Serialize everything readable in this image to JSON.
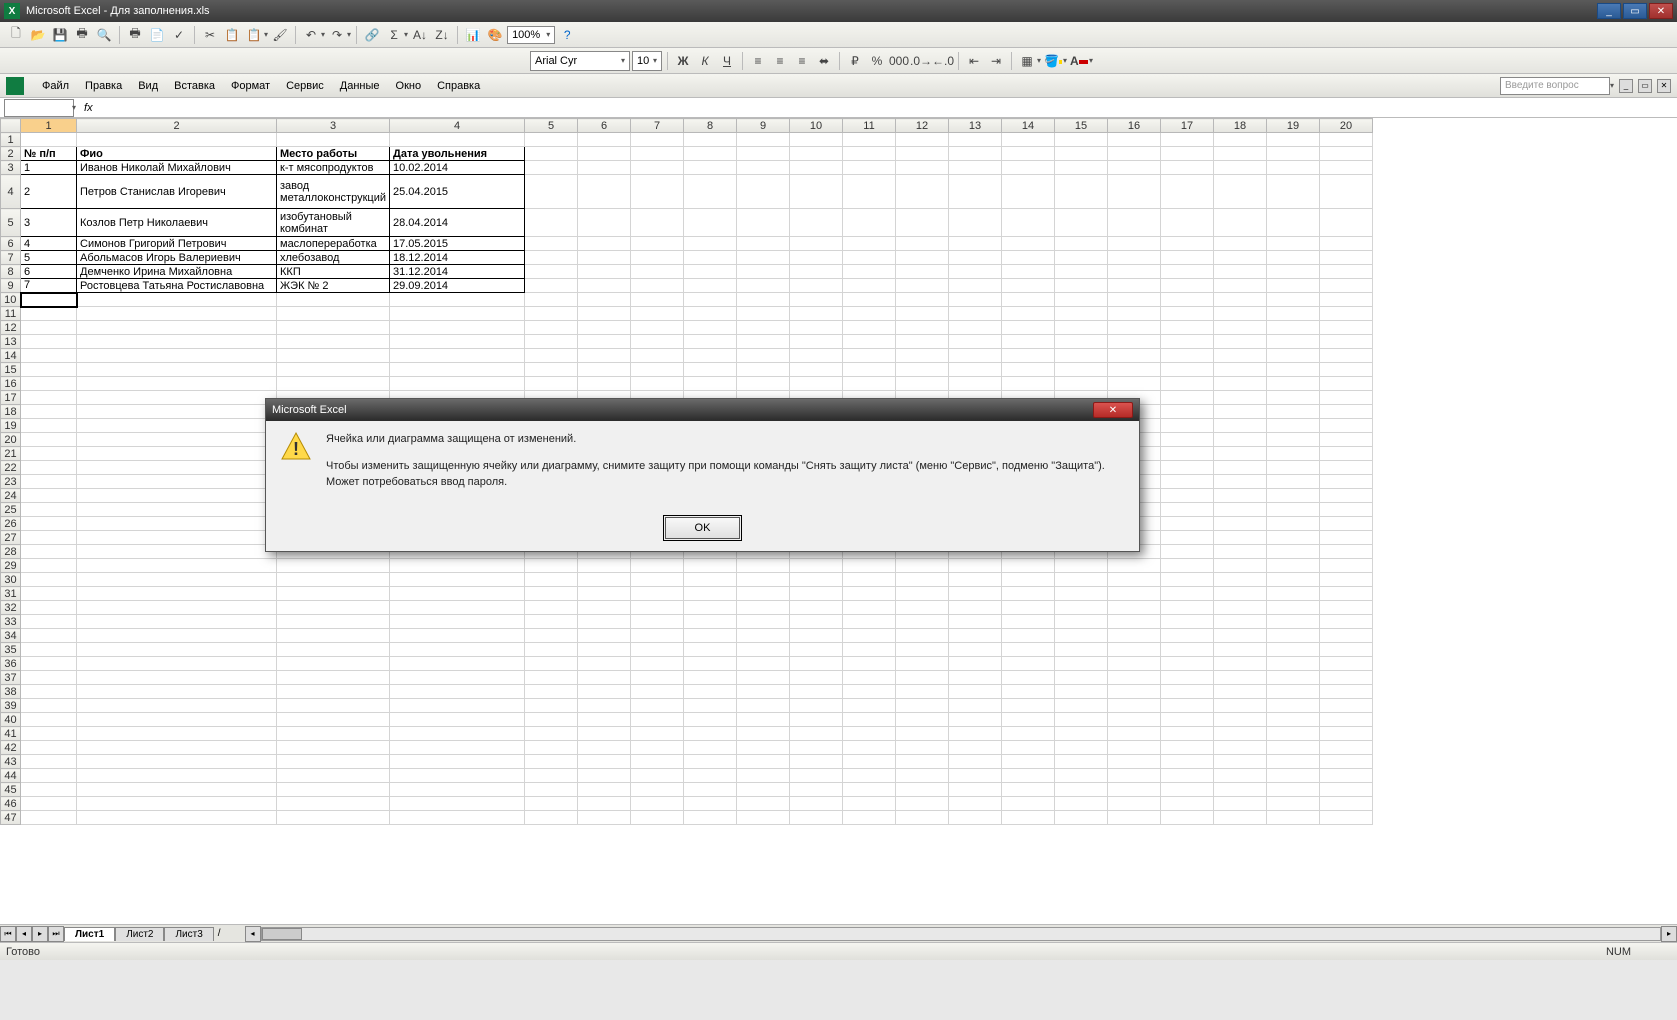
{
  "titlebar": {
    "app": "Microsoft Excel",
    "doc": "Для заполнения.xls"
  },
  "menu": {
    "items": [
      "Файл",
      "Правка",
      "Вид",
      "Вставка",
      "Формат",
      "Сервис",
      "Данные",
      "Окно",
      "Справка"
    ],
    "ask_placeholder": "Введите вопрос"
  },
  "toolbar": {
    "zoom": "100%"
  },
  "format": {
    "font": "Arial Cyr",
    "size": "10"
  },
  "namebox": "",
  "columns": [
    "1",
    "2",
    "3",
    "4",
    "5",
    "6",
    "7",
    "8",
    "9",
    "10",
    "11",
    "12",
    "13",
    "14",
    "15",
    "16",
    "17",
    "18",
    "19",
    "20"
  ],
  "row_headers": [
    "1",
    "2",
    "3",
    "4",
    "5",
    "6",
    "7",
    "8",
    "9",
    "10",
    "11",
    "12",
    "13",
    "14",
    "15",
    "16",
    "17",
    "18",
    "19",
    "20",
    "21",
    "22",
    "23",
    "24",
    "25",
    "26",
    "27",
    "28",
    "29",
    "30",
    "31",
    "32",
    "33",
    "34",
    "35",
    "36",
    "37",
    "38",
    "39",
    "40",
    "41",
    "42",
    "43",
    "44",
    "45",
    "46",
    "47"
  ],
  "headers": {
    "c1": "№ п/п",
    "c2": "Фио",
    "c3": "Место работы",
    "c4": "Дата увольнения"
  },
  "rows": [
    {
      "n": "1",
      "fio": "Иванов Николай Михайлович",
      "work": "к-т мясопродуктов",
      "date": "10.02.2014"
    },
    {
      "n": "2",
      "fio": "Петров Станислав Игоревич",
      "work": "завод металлоконструкций",
      "date": "25.04.2015"
    },
    {
      "n": "3",
      "fio": "Козлов Петр Николаевич",
      "work": "изобутановый комбинат",
      "date": "28.04.2014"
    },
    {
      "n": "4",
      "fio": "Симонов Григорий Петрович",
      "work": "маслопереработка",
      "date": "17.05.2015"
    },
    {
      "n": "5",
      "fio": "Абольмасов Игорь Валериевич",
      "work": "хлебозавод",
      "date": "18.12.2014"
    },
    {
      "n": "6",
      "fio": "Демченко Ирина Михайловна",
      "work": "ККП",
      "date": "31.12.2014"
    },
    {
      "n": "7",
      "fio": "Ростовцева Татьяна Ростиславовна",
      "work": "ЖЭК № 2",
      "date": "29.09.2014"
    }
  ],
  "sheets": {
    "tabs": [
      "Лист1",
      "Лист2",
      "Лист3"
    ],
    "active": 0
  },
  "status": {
    "left": "Готово",
    "right": "NUM"
  },
  "dialog": {
    "title": "Microsoft Excel",
    "line1": "Ячейка или диаграмма защищена от изменений.",
    "line2": "Чтобы изменить защищенную ячейку или диаграмму, снимите защиту при помощи команды \"Снять защиту листа\" (меню \"Сервис\", подменю \"Защита\"). Может потребоваться ввод пароля.",
    "ok": "OK"
  }
}
